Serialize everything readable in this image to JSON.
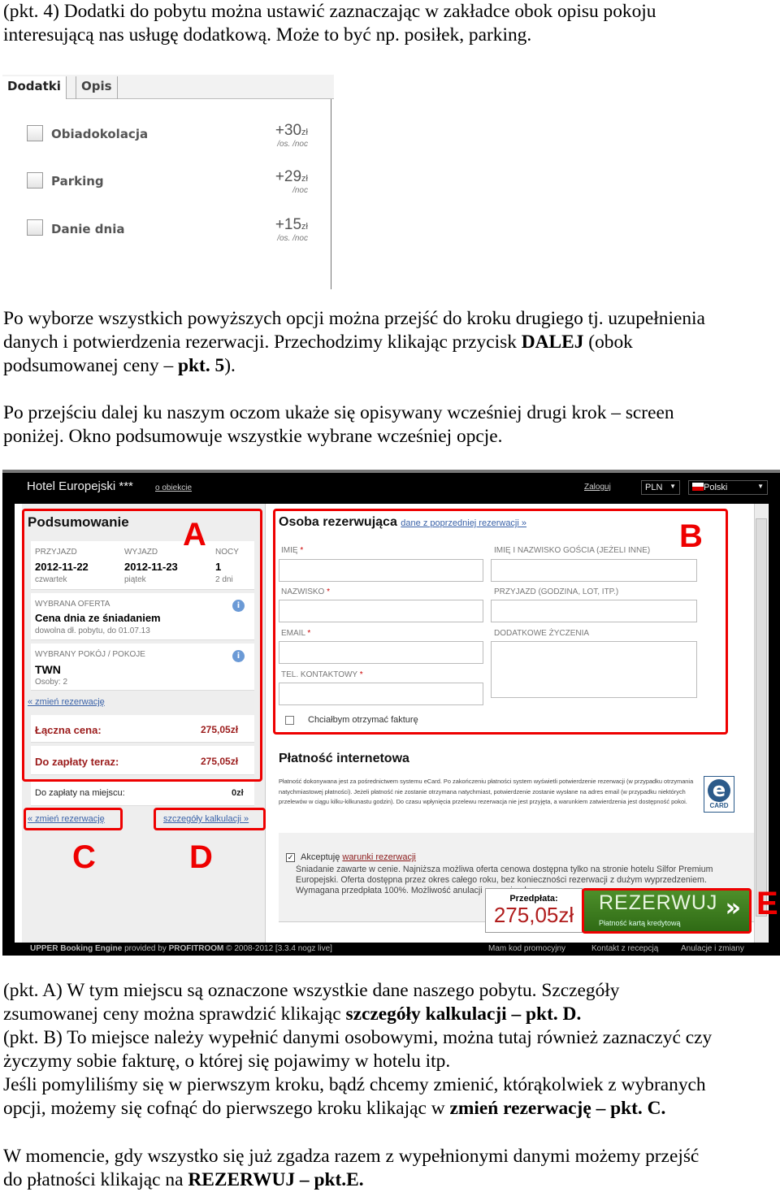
{
  "doc": {
    "p1": [
      "(pkt. 4) Dodatki do pobytu można ustawić zaznaczając w zakładce obok opisu pokoju",
      "interesującą nas usługę dodatkową. Może to być np. posiłek, parking."
    ],
    "p2a": "Po wyborze wszystkich powyższych opcji można przejść do kroku drugiego tj. uzupełnienia",
    "p2b": "danych i potwierdzenia rezerwacji. Przechodzimy klikając przycisk ",
    "p2b_bold": "DALEJ",
    "p2b_end": " (obok",
    "p2c": "podsumowanej ceny – ",
    "p2c_bold": "pkt. 5",
    "p2c_end": ").",
    "p3": [
      "Po przejściu dalej ku naszym oczom ukaże się opisywany wcześniej drugi krok – screen",
      "poniżej. Okno podsumowuje wszystkie wybrane wcześniej opcje."
    ],
    "p4a": "(pkt. A) W tym miejscu są oznaczone wszystkie dane naszego pobytu. Szczegóły",
    "p4b": "zsumowanej ceny można sprawdzić klikając ",
    "p4b_bold": "szczegóły kalkulacji – pkt. D.",
    "p4c": "(pkt. B) To miejsce należy wypełnić danymi osobowymi, można tutaj również zaznaczyć czy",
    "p4d": "życzymy sobie fakturę, o której się pojawimy w hotelu itp.",
    "p4e": "Jeśli pomyliliśmy się w pierwszym kroku, bądź chcemy zmienić, którąkolwiek z wybranych",
    "p4f": "opcji, możemy się cofnąć do pierwszego kroku klikając w ",
    "p4f_bold": "zmień rezerwację – pkt. C.",
    "p5a": "W momencie, gdy wszystko się już zgadza razem z wypełnionymi danymi możemy przejść",
    "p5b": "do płatności klikając na ",
    "p5b_bold": "REZERWUJ – pkt.E."
  },
  "addons": {
    "tabs": [
      "Dodatki",
      "Opis"
    ],
    "items": [
      {
        "name": "Obiadokolacja",
        "price": "+30",
        "currency": "zł",
        "unit": "/os. /noc",
        "checked": false
      },
      {
        "name": "Parking",
        "price": "+29",
        "currency": "zł",
        "unit": "/noc",
        "checked": false
      },
      {
        "name": "Danie dnia",
        "price": "+15",
        "currency": "zł",
        "unit": "/os. /noc",
        "checked": false
      }
    ]
  },
  "hotel": {
    "title": "Hotel Europejski ***",
    "about_link": "o obiekcie",
    "login": "Zaloguj",
    "currency": "PLN",
    "language": "Polski",
    "summary": {
      "title": "Podsumowanie",
      "arrival_label": "PRZYJAZD",
      "arrival": "2012-11-22",
      "arrival_day": "czwartek",
      "departure_label": "WYJAZD",
      "departure": "2012-11-23",
      "departure_day": "piątek",
      "nights_label": "NOCY",
      "nights": "1",
      "days": "2 dni",
      "offer_label": "WYBRANA OFERTA",
      "offer": "Cena dnia ze śniadaniem",
      "offer_desc": "dowolna dł. pobytu, do 01.07.13",
      "room_label": "WYBRANY POKÓJ / POKOJE",
      "room": "TWN",
      "persons": "Osoby: 2",
      "change_link": "« zmień rezerwację",
      "total_label": "Łączna cena:",
      "total": "275,05zł",
      "now_label": "Do zapłaty teraz:",
      "now": "275,05zł",
      "onsite_label": "Do zapłaty na miejscu:",
      "onsite": "0zł",
      "change_link2": "« zmień rezerwację",
      "details_link": "szczegóły kalkulacji »"
    },
    "form": {
      "title": "Osoba rezerwująca",
      "prev_link": "dane z poprzedniej rezerwacji »",
      "first_name": "IMIĘ",
      "last_name": "NAZWISKO",
      "email": "EMAIL",
      "phone": "TEL. KONTAKTOWY",
      "required": "*",
      "guest": "IMIĘ I NAZWISKO GOŚCIA (JEŻELI INNE)",
      "arrival_info": "PRZYJAZD (GODZINA, LOT, ITP.)",
      "wishes": "DODATKOWE ŻYCZENIA",
      "invoice": "Chciałbym otrzymać fakturę"
    },
    "payment": {
      "title": "Płatność internetowa",
      "text": "Płatność dokonywana jest za pośrednictwem systemu eCard. Po zakończeniu płatności system wyświetli potwierdzenie rezerwacji (w przypadku otrzymania natychmiastowej płatności). Jeżeli płatność nie zostanie otrzymana natychmiast, potwierdzenie zostanie wysłane na adres email (w przypadku niektórych przelewów w ciągu kilku-kilkunastu godzin). Do czasu wpłynięcia przelewu rezerwacja nie jest przyjęta, a warunkiem zatwierdzenia jest dostępność pokoi.",
      "logo": "CARD",
      "accept": "Akceptuję ",
      "terms_link": "warunki rezerwacji",
      "terms_text": "Śniadanie zawarte w cenie. Najniższa możliwa oferta cenowa dostępna tylko na stronie hotelu Silfor Premium Europejski. Oferta dostępna przez okres całego roku, bez konieczności rezerwacji z dużym wyprzedzeniem. Wymagana  przedpłata 100%. Możliwość anulacji ... przyjazdu.",
      "prepay_label": "Przedpłata:",
      "prepay": "275,05zł",
      "book": "REZERWUJ",
      "book_sub": "Płatność kartą kredytową"
    },
    "footer": {
      "engine": "UPPER Booking Engine",
      "provided": " provided by ",
      "brand": "PROFITROOM",
      "copy": " © 2008-2012 [3.3.4 nogz live]",
      "links": [
        "Mam kod promocyjny",
        "Kontakt z recepcją",
        "Anulacje i zmiany"
      ]
    },
    "marks": [
      "A",
      "B",
      "C",
      "D",
      "E"
    ]
  },
  "colors": {
    "annotation": "#e00000",
    "price": "#9b1b1b",
    "book_green": "#3f7f1f",
    "link": "#3a62a8"
  }
}
